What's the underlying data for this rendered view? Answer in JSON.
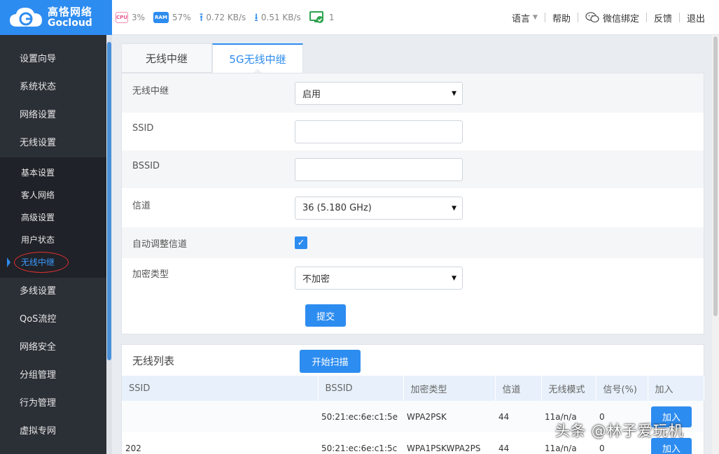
{
  "brand": {
    "name_cn": "高恪网络",
    "name_en": "Gocloud",
    "color": "#2d8cf0"
  },
  "stats": {
    "cpu_chip": "CPU",
    "cpu": "3%",
    "ram_chip": "RAM",
    "ram": "57%",
    "upload": "0.72 KB/s",
    "download": "0.51 KB/s",
    "devices": "1"
  },
  "topnav": {
    "language": "语言",
    "help": "帮助",
    "wechat": "微信绑定",
    "feedback": "反馈",
    "logout": "退出"
  },
  "sidebar": {
    "items_top": [
      "设置向导",
      "系统状态",
      "网络设置",
      "无线设置"
    ],
    "sub_items": [
      "基本设置",
      "客人网络",
      "高级设置",
      "用户状态",
      "无线中继"
    ],
    "active_sub": "无线中继",
    "items_bottom": [
      "多线设置",
      "QoS流控",
      "网络安全",
      "分组管理",
      "行为管理",
      "虚拟专网"
    ]
  },
  "tabs": [
    "无线中继",
    "5G无线中继"
  ],
  "active_tab": "5G无线中继",
  "form": {
    "repeater_label": "无线中继",
    "repeater_value": "启用",
    "ssid_label": "SSID",
    "ssid_value": "",
    "bssid_label": "BSSID",
    "bssid_value": "",
    "channel_label": "信道",
    "channel_value": "36 (5.180 GHz)",
    "auto_channel_label": "自动调整信道",
    "auto_channel_checked": true,
    "encryption_label": "加密类型",
    "encryption_value": "不加密",
    "submit_label": "提交"
  },
  "list": {
    "title": "无线列表",
    "scan_label": "开始扫描",
    "columns": [
      "SSID",
      "BSSID",
      "加密类型",
      "信道",
      "无线模式",
      "信号(%)",
      "加入"
    ],
    "rows": [
      {
        "ssid": "",
        "bssid": "50:21:ec:6e:c1:5e",
        "enc": "WPA2PSK",
        "channel": "44",
        "mode": "11a/n/a",
        "signal": "0",
        "join": "加入"
      },
      {
        "ssid": "202",
        "bssid": "50:21:ec:6e:c1:5c",
        "enc": "WPA1PSKWPA2PS",
        "channel": "44",
        "mode": "11a/n/a",
        "signal": "0",
        "join": "加入"
      }
    ]
  },
  "watermark": "头条 @林子爱玩机"
}
